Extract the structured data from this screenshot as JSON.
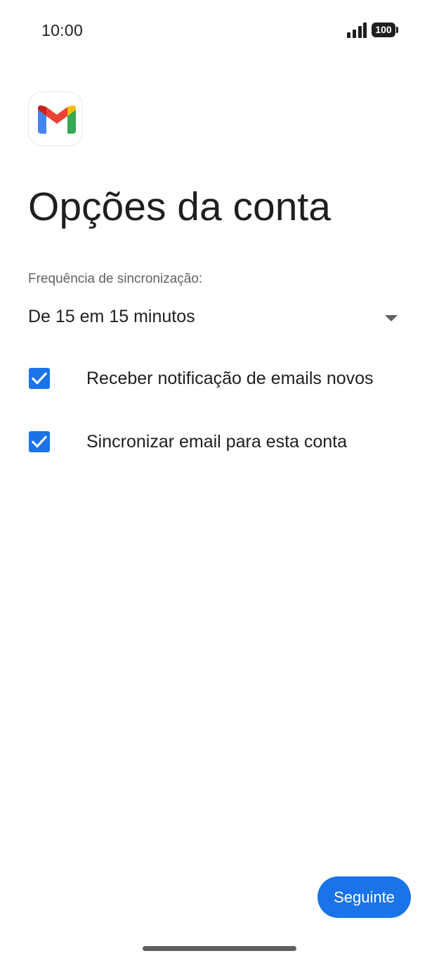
{
  "status_bar": {
    "time": "10:00",
    "battery": "100",
    "icons": [
      "signal-icon",
      "battery-icon"
    ]
  },
  "app_icon": "gmail-logo-icon",
  "page": {
    "title": "Opções da conta"
  },
  "sync": {
    "label": "Frequência de sincronização:",
    "selected": "De 15 em 15 minutos"
  },
  "options": [
    {
      "label": "Receber notificação de emails novos",
      "checked": true
    },
    {
      "label": "Sincronizar email para esta conta",
      "checked": true
    }
  ],
  "actions": {
    "next_label": "Seguinte"
  },
  "colors": {
    "accent": "#1a73e8",
    "text": "#1f1f1f",
    "secondary_text": "#5f6368"
  }
}
